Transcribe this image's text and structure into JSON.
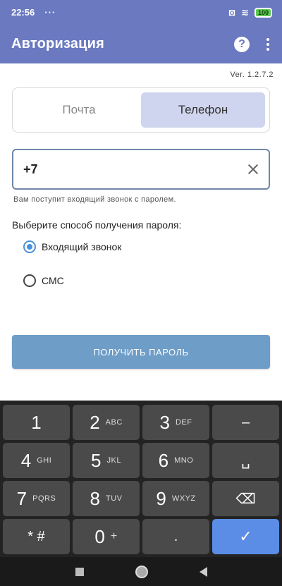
{
  "status_bar": {
    "time": "22:56",
    "battery": "100"
  },
  "app_bar": {
    "title": "Авторизация"
  },
  "version": "Ver. 1.2.7.2",
  "tabs": [
    {
      "label": "Почта",
      "active": false
    },
    {
      "label": "Телефон",
      "active": true
    }
  ],
  "phone": {
    "value": "+7",
    "hint": "Вам поступит входящий звонок с паролем."
  },
  "method": {
    "label": "Выберите способ получения пароля:",
    "options": [
      {
        "label": "Входящий звонок",
        "checked": true
      },
      {
        "label": "СМС",
        "checked": false
      }
    ]
  },
  "button": {
    "label": "ПОЛУЧИТЬ ПАРОЛЬ"
  },
  "keyboard": {
    "keys": [
      {
        "digit": "1",
        "letters": ""
      },
      {
        "digit": "2",
        "letters": "ABC"
      },
      {
        "digit": "3",
        "letters": "DEF"
      },
      {
        "digit": "–",
        "letters": ""
      },
      {
        "digit": "4",
        "letters": "GHI"
      },
      {
        "digit": "5",
        "letters": "JKL"
      },
      {
        "digit": "6",
        "letters": "MNO"
      },
      {
        "digit": "␣",
        "letters": ""
      },
      {
        "digit": "7",
        "letters": "PQRS"
      },
      {
        "digit": "8",
        "letters": "TUV"
      },
      {
        "digit": "9",
        "letters": "WXYZ"
      },
      {
        "digit": "⌫",
        "letters": ""
      },
      {
        "digit": "* #",
        "letters": ""
      },
      {
        "digit": "0",
        "letters": "+"
      },
      {
        "digit": ".",
        "letters": ""
      },
      {
        "digit": "✓",
        "letters": ""
      }
    ]
  },
  "colors": {
    "app_bar": "#6a79c0",
    "active_tab": "#cfd5ee",
    "button": "#6e9dc8",
    "radio_accent": "#4a90d9",
    "done_key": "#5b8de6"
  }
}
